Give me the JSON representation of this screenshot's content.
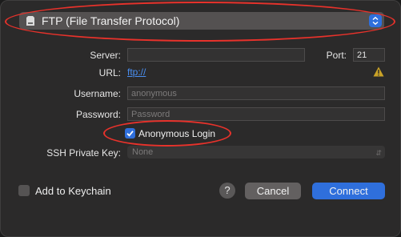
{
  "protocol": {
    "label": "FTP (File Transfer Protocol)"
  },
  "server": {
    "label": "Server:",
    "value": ""
  },
  "port": {
    "label": "Port:",
    "value": "21"
  },
  "url": {
    "label": "URL:",
    "value": "ftp://"
  },
  "username": {
    "label": "Username:",
    "placeholder": "anonymous"
  },
  "password": {
    "label": "Password:",
    "placeholder": "Password"
  },
  "anonymous_login": {
    "label": "Anonymous Login",
    "checked": true
  },
  "ssh_key": {
    "label": "SSH Private Key:",
    "value": "None"
  },
  "keychain": {
    "label": "Add to Keychain",
    "checked": false
  },
  "buttons": {
    "help": "?",
    "cancel": "Cancel",
    "connect": "Connect"
  },
  "colors": {
    "accent": "#2f6fdc",
    "annotation": "#e8322b",
    "link": "#4a8ff2",
    "warning": "#c9a227"
  }
}
